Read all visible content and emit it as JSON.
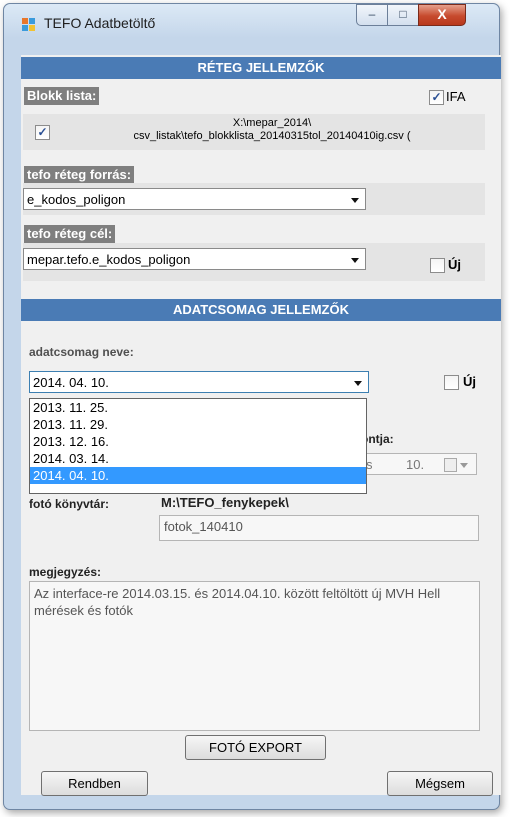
{
  "window": {
    "title": "TEFO Adatbetöltő",
    "minimize": "‒",
    "maximize": "□",
    "close": "X"
  },
  "layer_section": {
    "header": "RÉTEG JELLEMZŐK",
    "block_list_label": "Blokk lista:",
    "ifa_label": "IFA",
    "ifa_checked": true,
    "block_checked": true,
    "block_path_line1": "X:\\mepar_2014\\",
    "block_path_line2": "csv_listak\\tefo_blokklista_20140315tol_20140410ig.csv (",
    "source_label": "tefo réteg forrás:",
    "source_value": "e_kodos_poligon",
    "target_label": "tefo réteg cél:",
    "target_value": "mepar.tefo.e_kodos_poligon",
    "new_label": "Új",
    "new_checked": false
  },
  "package_section": {
    "header": "ADATCSOMAG JELLEMZŐK",
    "name_label": "adatcsomag neve:",
    "name_value": "2014. 04. 10.",
    "new_label": "Új",
    "new_checked": false,
    "date_options": [
      "2013. 11. 25.",
      "2013. 11. 29.",
      "2013. 12. 16.",
      "2014. 03. 14.",
      "2014. 04. 10."
    ],
    "selected_index": 4,
    "time_label_partial": "ontja:",
    "time_partial_left": "s",
    "time_partial_day": "10.",
    "photo_dir_label": "fotó könyvtár:",
    "photo_dir_path": "M:\\TEFO_fenykepek\\",
    "photo_dir_value": "fotok_140410",
    "comment_label": "megjegyzés:",
    "comment_value": "Az interface-re 2014.03.15. és 2014.04.10. között feltöltött új MVH Hell mérések és fotók"
  },
  "buttons": {
    "photo_export": "FOTÓ EXPORT",
    "ok": "Rendben",
    "cancel": "Mégsem"
  },
  "colors": {
    "section_header": "#4a7bb5",
    "selection": "#3399ff",
    "label_bg": "#7f7f7f"
  }
}
